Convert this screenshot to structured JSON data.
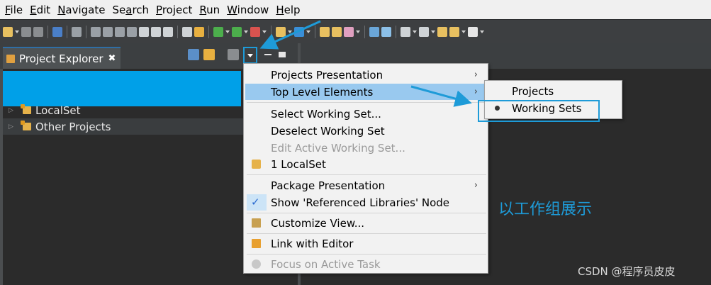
{
  "menubar": {
    "items": [
      {
        "label": "File",
        "mnemonic": "F"
      },
      {
        "label": "Edit",
        "mnemonic": "E"
      },
      {
        "label": "Navigate",
        "mnemonic": "N"
      },
      {
        "label": "Search",
        "mnemonic": "a"
      },
      {
        "label": "Project",
        "mnemonic": "P"
      },
      {
        "label": "Run",
        "mnemonic": "R"
      },
      {
        "label": "Window",
        "mnemonic": "W"
      },
      {
        "label": "Help",
        "mnemonic": "H"
      }
    ]
  },
  "explorer": {
    "tab_title": "Project Explorer",
    "close_glyph": "✖",
    "tree": [
      {
        "label": "LocalSet"
      },
      {
        "label": "Other Projects"
      }
    ]
  },
  "context_menu": {
    "items": [
      {
        "label": "Projects Presentation",
        "submenu_glyph": "›"
      },
      {
        "label": "Top Level Elements",
        "submenu_glyph": "›"
      },
      {
        "label": "Select Working Set..."
      },
      {
        "label": "Deselect Working Set"
      },
      {
        "label": "Edit Active Working Set..."
      },
      {
        "label": "1 LocalSet"
      },
      {
        "label": "Package Presentation",
        "submenu_glyph": "›"
      },
      {
        "label": "Show 'Referenced Libraries' Node",
        "check_glyph": "✓"
      },
      {
        "label": "Customize View..."
      },
      {
        "label": "Link with Editor"
      },
      {
        "label": "Focus on Active Task"
      }
    ]
  },
  "submenu": {
    "items": [
      {
        "label": "Projects"
      },
      {
        "label": "Working Sets"
      }
    ]
  },
  "annotation": {
    "text": "以工作组展示"
  },
  "watermark": {
    "text": "CSDN @程序员皮皮"
  },
  "colors": {
    "accent": "#1e9bd8",
    "menu_highlight": "#99c9ef",
    "explorer_bg": "#2b2b2b",
    "menu_bg": "#f2f2f2"
  }
}
